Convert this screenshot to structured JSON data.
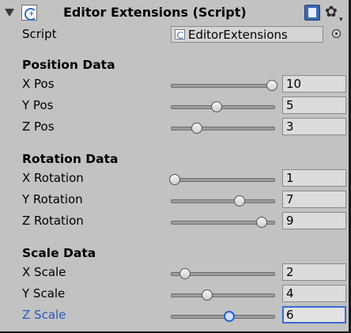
{
  "header": {
    "title": "Editor Extensions (Script)"
  },
  "script_row": {
    "label": "Script",
    "value": "EditorExtensions"
  },
  "sections": [
    {
      "title": "Position Data",
      "rows": [
        {
          "label": "X Pos",
          "value": "10",
          "slider_fraction": 0.97
        },
        {
          "label": "Y Pos",
          "value": "5",
          "slider_fraction": 0.44
        },
        {
          "label": "Z Pos",
          "value": "3",
          "slider_fraction": 0.25
        }
      ]
    },
    {
      "title": "Rotation Data",
      "rows": [
        {
          "label": "X Rotation",
          "value": "1",
          "slider_fraction": 0.04
        },
        {
          "label": "Y Rotation",
          "value": "7",
          "slider_fraction": 0.66
        },
        {
          "label": "Z Rotation",
          "value": "9",
          "slider_fraction": 0.87
        }
      ]
    },
    {
      "title": "Scale Data",
      "rows": [
        {
          "label": "X Scale",
          "value": "2",
          "slider_fraction": 0.14
        },
        {
          "label": "Y Scale",
          "value": "4",
          "slider_fraction": 0.35
        },
        {
          "label": "Z Scale",
          "value": "6",
          "slider_fraction": 0.56,
          "focused": true
        }
      ]
    }
  ],
  "colors": {
    "background": "#c2c2c2",
    "focus": "#2855c4"
  },
  "icons": {
    "foldout": "foldout-arrow-icon",
    "script": "script-icon",
    "help": "help-book-icon",
    "settings": "gear-icon",
    "object_picker": "object-picker-icon"
  }
}
